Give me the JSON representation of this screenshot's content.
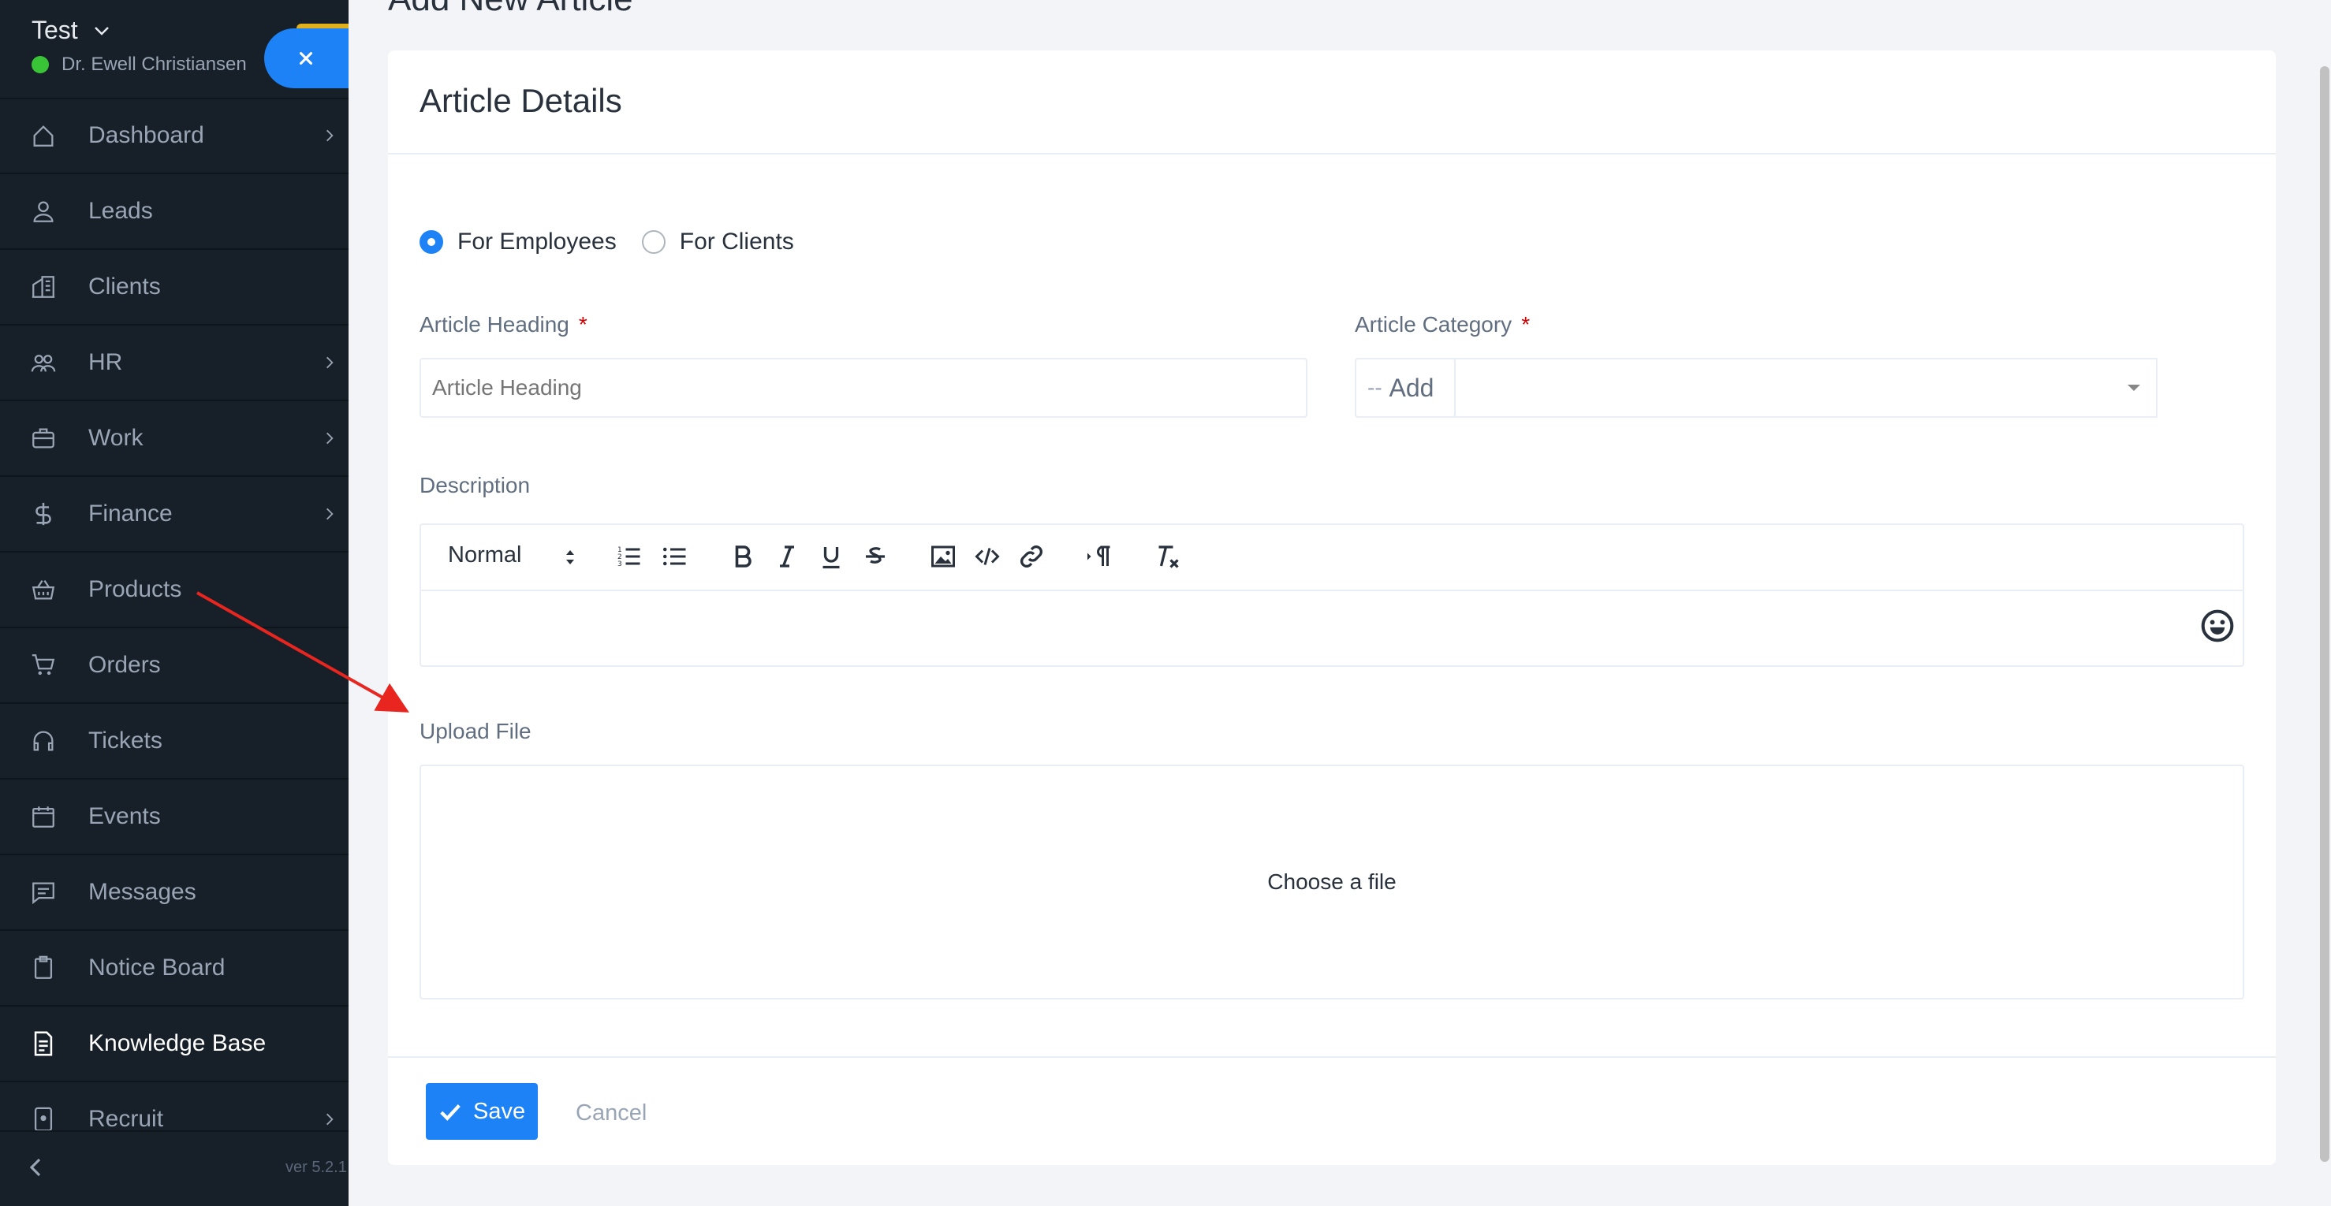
{
  "sidebar": {
    "company": "Test",
    "user_name": "Dr. Ewell Christiansen",
    "version": "ver 5.2.1",
    "items": [
      {
        "label": "Dashboard",
        "icon": "home-icon",
        "chevron": true
      },
      {
        "label": "Leads",
        "icon": "user-icon",
        "chevron": false
      },
      {
        "label": "Clients",
        "icon": "building-icon",
        "chevron": false
      },
      {
        "label": "HR",
        "icon": "people-icon",
        "chevron": true
      },
      {
        "label": "Work",
        "icon": "briefcase-icon",
        "chevron": true
      },
      {
        "label": "Finance",
        "icon": "dollar-icon",
        "chevron": true
      },
      {
        "label": "Products",
        "icon": "basket-icon",
        "chevron": false
      },
      {
        "label": "Orders",
        "icon": "cart-icon",
        "chevron": false
      },
      {
        "label": "Tickets",
        "icon": "headset-icon",
        "chevron": false
      },
      {
        "label": "Events",
        "icon": "calendar-icon",
        "chevron": false
      },
      {
        "label": "Messages",
        "icon": "message-icon",
        "chevron": false
      },
      {
        "label": "Notice Board",
        "icon": "clipboard-icon",
        "chevron": false
      },
      {
        "label": "Knowledge Base",
        "icon": "document-icon",
        "chevron": false,
        "active": true
      },
      {
        "label": "Recruit",
        "icon": "id-badge-icon",
        "chevron": true
      }
    ]
  },
  "page": {
    "title": "Add New Article"
  },
  "form": {
    "card_title": "Article Details",
    "visibility": {
      "options": [
        "For Employees",
        "For Clients"
      ],
      "selected": "For Employees"
    },
    "heading_label": "Article Heading",
    "heading_placeholder": "Article Heading",
    "category_label": "Article Category",
    "category_value": "--",
    "add_label": "Add",
    "required_mark": "*",
    "description_label": "Description",
    "editor_format": "Normal",
    "upload_label": "Upload File",
    "dropzone_text": "Choose a file",
    "save_label": "Save",
    "cancel_label": "Cancel"
  },
  "colors": {
    "primary": "#1d82f5",
    "sidebar_bg": "#171f29",
    "online": "#39c336",
    "required": "#d30000",
    "annotation_arrow": "#e8261f"
  }
}
